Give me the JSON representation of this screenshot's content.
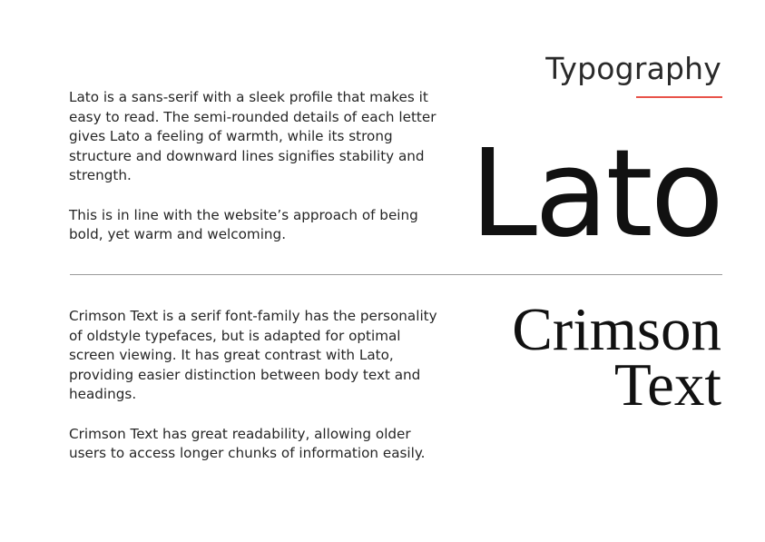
{
  "section_title": "Typography",
  "accent_color": "#e8534a",
  "lato": {
    "sample": "Lato",
    "paragraphs": [
      "Lato is a sans-serif with a sleek profile that makes it easy to read. The semi-rounded details of each letter gives Lato a feeling of warmth, while its strong structure and downward lines signifies stability and strength.",
      "This is in line with the website’s approach of being bold, yet warm and welcoming."
    ]
  },
  "crimson": {
    "sample_line1": "Crimson",
    "sample_line2": "Text",
    "paragraphs": [
      "Crimson Text is a serif font-family has the personality of oldstyle typefaces, but is adapted for optimal screen viewing. It has great contrast with Lato, providing easier distinction between body text and headings.",
      "Crimson Text has great readability, allowing older users to access longer chunks of information easily."
    ]
  }
}
